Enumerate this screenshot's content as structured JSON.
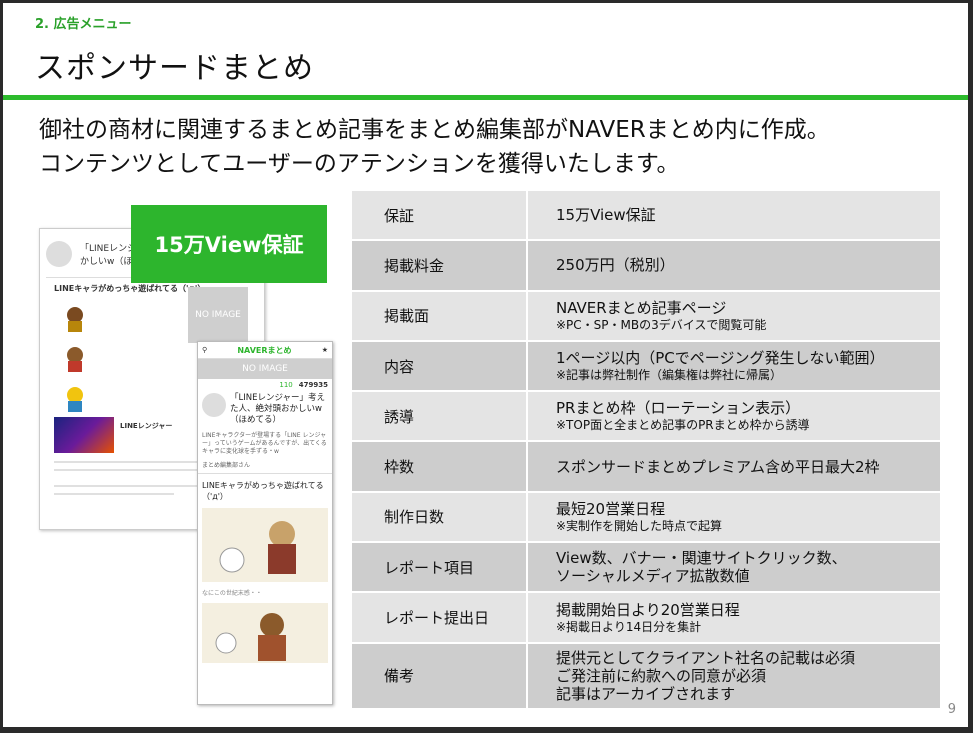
{
  "header": {
    "section": "2. 広告メニュー",
    "title": "スポンサードまとめ"
  },
  "lead": {
    "line1": "御社の商材に関連するまとめ記事をまとめ編集部がNAVERまとめ内に作成。",
    "line2": "コンテンツとしてユーザーのアテンションを獲得いたします。"
  },
  "badge": "15万View保証",
  "mock": {
    "article_title": "「LINEレンジャー」考えた人、絶対頭おかしいw（ほめてる）",
    "article_title_short": "「LINEレンジャー」\nかしいw（ほめてる",
    "heading": "LINEキャラがめっちゃ遊ばれてる（'д'）",
    "no_image": "NO IMAGE",
    "naver_logo": "NAVERまとめ",
    "views": "479935",
    "likes": "110",
    "caption": "なにこの世紀末感・・",
    "desc": "LINEキャラクターが登場する「LINE レンジャー」っていうゲームがあるんですが、出てくるキャラに変化球を手ずる・w",
    "editor": "まとめ編集部さん",
    "line_ranger": "LINEレンジャー"
  },
  "table": [
    {
      "label": "保証",
      "value": "15万View保証",
      "note": ""
    },
    {
      "label": "掲載料金",
      "value": "250万円（税別）",
      "note": ""
    },
    {
      "label": "掲載面",
      "value": "NAVERまとめ記事ページ",
      "note": "※PC・SP・MBの3デバイスで閲覧可能"
    },
    {
      "label": "内容",
      "value": "1ページ以内（PCでページング発生しない範囲）",
      "note": "※記事は弊社制作（編集権は弊社に帰属）"
    },
    {
      "label": "誘導",
      "value": "PRまとめ枠（ローテーション表示）",
      "note": "※TOP面と全まとめ記事のPRまとめ枠から誘導"
    },
    {
      "label": "枠数",
      "value": "スポンサードまとめプレミアム含め平日最大2枠",
      "note": ""
    },
    {
      "label": "制作日数",
      "value": "最短20営業日程",
      "note": "※実制作を開始した時点で起算"
    },
    {
      "label": "レポート項目",
      "value": "View数、バナー・関連サイトクリック数、",
      "value2": "ソーシャルメディア拡散数値",
      "note": ""
    },
    {
      "label": "レポート提出日",
      "value": "掲載開始日より20営業日程",
      "note": "※掲載日より14日分を集計"
    },
    {
      "label": "備考",
      "value": "提供元としてクライアント社名の記載は必須",
      "value2": "ご発注前に約款への同意が必須",
      "value3": "記事はアーカイブされます",
      "note": ""
    }
  ],
  "page_number": "9"
}
